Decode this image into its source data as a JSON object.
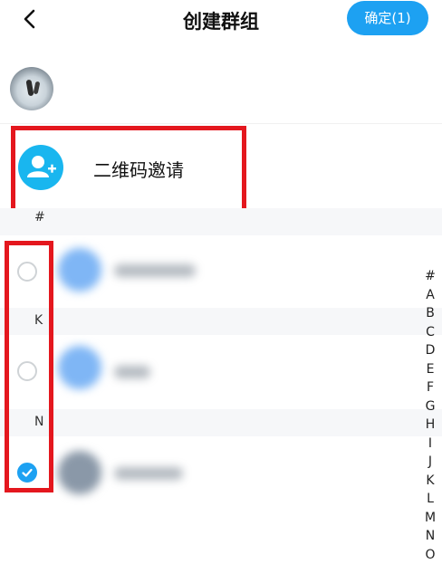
{
  "header": {
    "title": "创建群组",
    "confirm_label": "确定(1)"
  },
  "qr_invite": {
    "label": "二维码邀请"
  },
  "sections": [
    {
      "letter": "#"
    },
    {
      "letter": "K"
    },
    {
      "letter": "N"
    }
  ],
  "contacts": [
    {
      "selected": false
    },
    {
      "selected": false
    },
    {
      "selected": true
    }
  ],
  "index_letters": [
    "#",
    "A",
    "B",
    "C",
    "D",
    "E",
    "F",
    "G",
    "H",
    "I",
    "J",
    "K",
    "L",
    "M",
    "N",
    "O"
  ],
  "colors": {
    "accent": "#1da1f2",
    "highlight": "#e4171e",
    "qr_icon": "#19b6ef"
  }
}
